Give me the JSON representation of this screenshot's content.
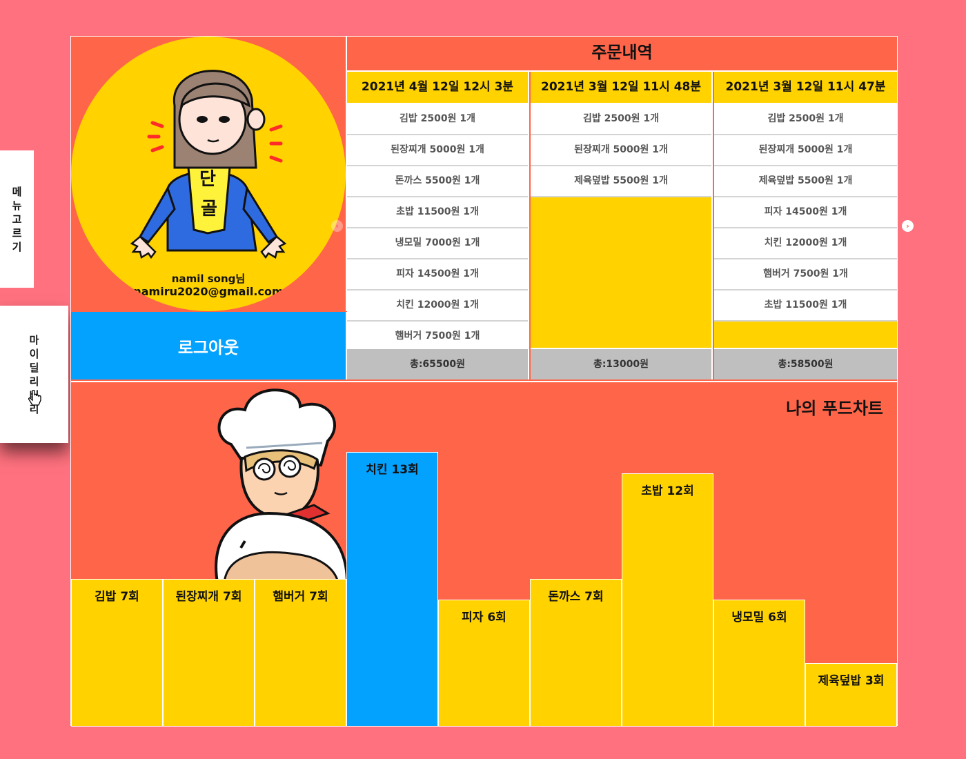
{
  "sidebar": {
    "menu_tab_chars": [
      "메",
      "뉴",
      "고",
      "르",
      "기"
    ],
    "mydelivery_tab_chars": [
      "마",
      "이",
      "딜",
      "리",
      "버",
      "리"
    ]
  },
  "profile": {
    "user_name": "namil song님",
    "user_email": "namiru2020@gmail.com",
    "logout_label": "로그아웃",
    "badge_text": [
      "단",
      "골"
    ]
  },
  "orders": {
    "title": "주문내역",
    "columns": [
      {
        "date": "2021년 4월 12일  12시 3분",
        "items": [
          "김밥 2500원 1개",
          "된장찌개 5000원 1개",
          "돈까스 5500원 1개",
          "초밥 11500원 1개",
          "냉모밀 7000원 1개",
          "피자 14500원 1개",
          "치킨 12000원 1개",
          "햄버거 7500원 1개"
        ],
        "total": "총:65500원"
      },
      {
        "date": "2021년 3월 12일  11시 48분",
        "items": [
          "김밥 2500원 1개",
          "된장찌개 5000원 1개",
          "제육덮밥 5500원 1개"
        ],
        "total": "총:13000원"
      },
      {
        "date": "2021년 3월 12일  11시 47분",
        "items": [
          "김밥 2500원 1개",
          "된장찌개 5000원 1개",
          "제육덮밥 5500원 1개",
          "피자 14500원 1개",
          "치킨 12000원 1개",
          "햄버거 7500원 1개",
          "초밥 11500원 1개"
        ],
        "total": "총:58500원"
      }
    ]
  },
  "chart_data": {
    "type": "bar",
    "title": "나의 푸드차트",
    "categories": [
      "김밥",
      "된장찌개",
      "햄버거",
      "치킨",
      "피자",
      "돈까스",
      "초밥",
      "냉모밀",
      "제육덮밥"
    ],
    "values": [
      7,
      7,
      7,
      13,
      6,
      7,
      12,
      6,
      3
    ],
    "labels": [
      "김밥 7회",
      "된장찌개 7회",
      "햄버거 7회",
      "치킨 13회",
      "피자 6회",
      "돈까스 7회",
      "초밥 12회",
      "냉모밀 6회",
      "제육덮밥 3회"
    ],
    "highlight_index": 3,
    "colors": {
      "default": "#ffd200",
      "highlight": "#03a2ff"
    }
  },
  "colors": {
    "page_background": "#ff717e",
    "panel": "#ff6549",
    "accent_yellow": "#ffd200",
    "accent_blue": "#03a2ff"
  }
}
